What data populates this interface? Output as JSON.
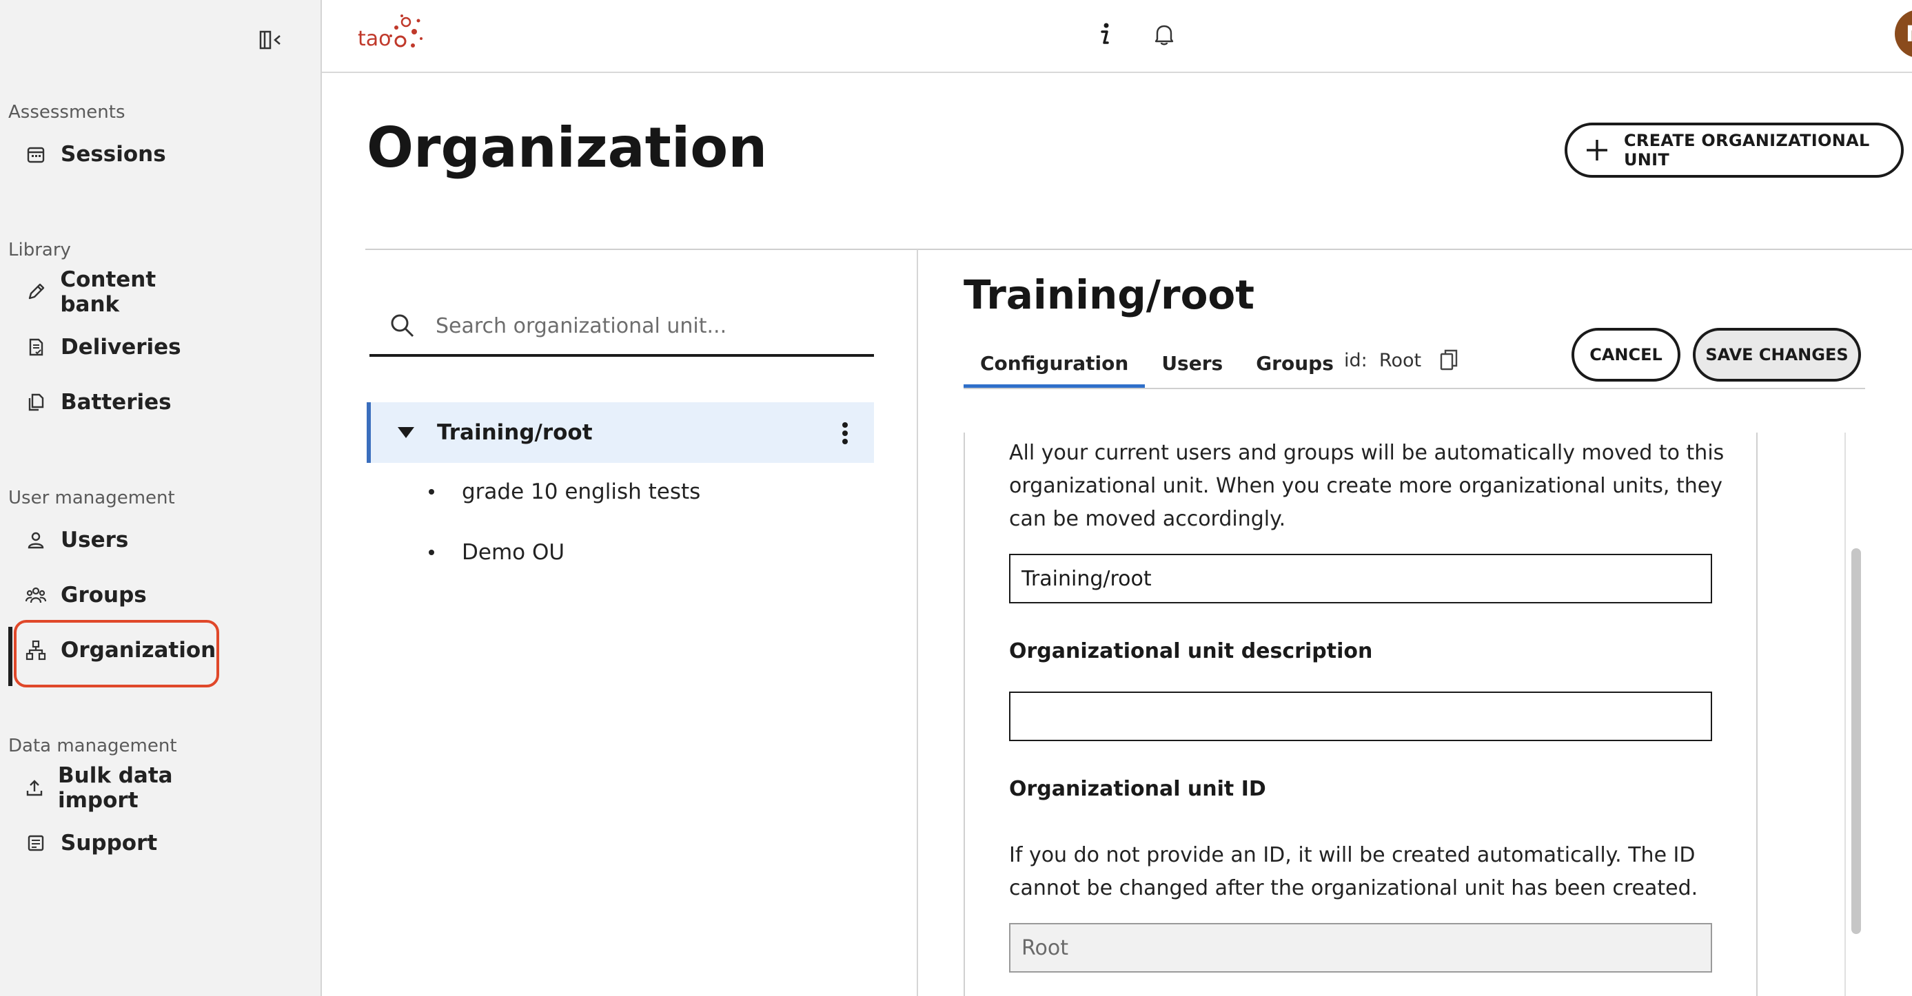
{
  "sidebar": {
    "sections": [
      {
        "label": "Assessments",
        "items": [
          {
            "label": "Sessions",
            "icon": "calendar-icon"
          }
        ]
      },
      {
        "label": "Library",
        "items": [
          {
            "label": "Content bank",
            "icon": "pencil-icon"
          },
          {
            "label": "Deliveries",
            "icon": "document-check-icon"
          },
          {
            "label": "Batteries",
            "icon": "documents-icon"
          }
        ]
      },
      {
        "label": "User management",
        "items": [
          {
            "label": "Users",
            "icon": "user-icon"
          },
          {
            "label": "Groups",
            "icon": "groups-icon"
          },
          {
            "label": "Organization",
            "icon": "org-chart-icon"
          }
        ]
      },
      {
        "label": "Data management",
        "items": [
          {
            "label": "Bulk data import",
            "icon": "upload-icon"
          },
          {
            "label": "Support",
            "icon": "support-icon"
          }
        ]
      }
    ],
    "active_item": "Organization"
  },
  "topbar": {
    "logo_text": "tao",
    "avatar_initial": "N",
    "accent_color": "#c0392b"
  },
  "page": {
    "title": "Organization",
    "create_button_label": "CREATE ORGANIZATIONAL UNIT"
  },
  "tree": {
    "search_placeholder": "Search organizational unit...",
    "root": {
      "label": "Training/root"
    },
    "children": [
      "grade 10 english tests",
      "Demo OU"
    ]
  },
  "detail": {
    "title": "Training/root",
    "tabs": [
      "Configuration",
      "Users",
      "Groups"
    ],
    "active_tab": "Configuration",
    "id_prefix": "id:",
    "id_value": "Root",
    "cancel_label": "CANCEL",
    "save_label": "SAVE CHANGES",
    "intro_text": "All your current users and groups will be automatically moved to this organizational unit. When you create more organizational units, they can be moved accordingly.",
    "name_value": "Training/root",
    "description_label": "Organizational unit description",
    "description_value": "",
    "id_field_label": "Organizational unit ID",
    "id_help_text": "If you do not provide an ID, it will be created automatically. The ID cannot be changed after the organizational unit has been created.",
    "id_field_value": "Root"
  }
}
